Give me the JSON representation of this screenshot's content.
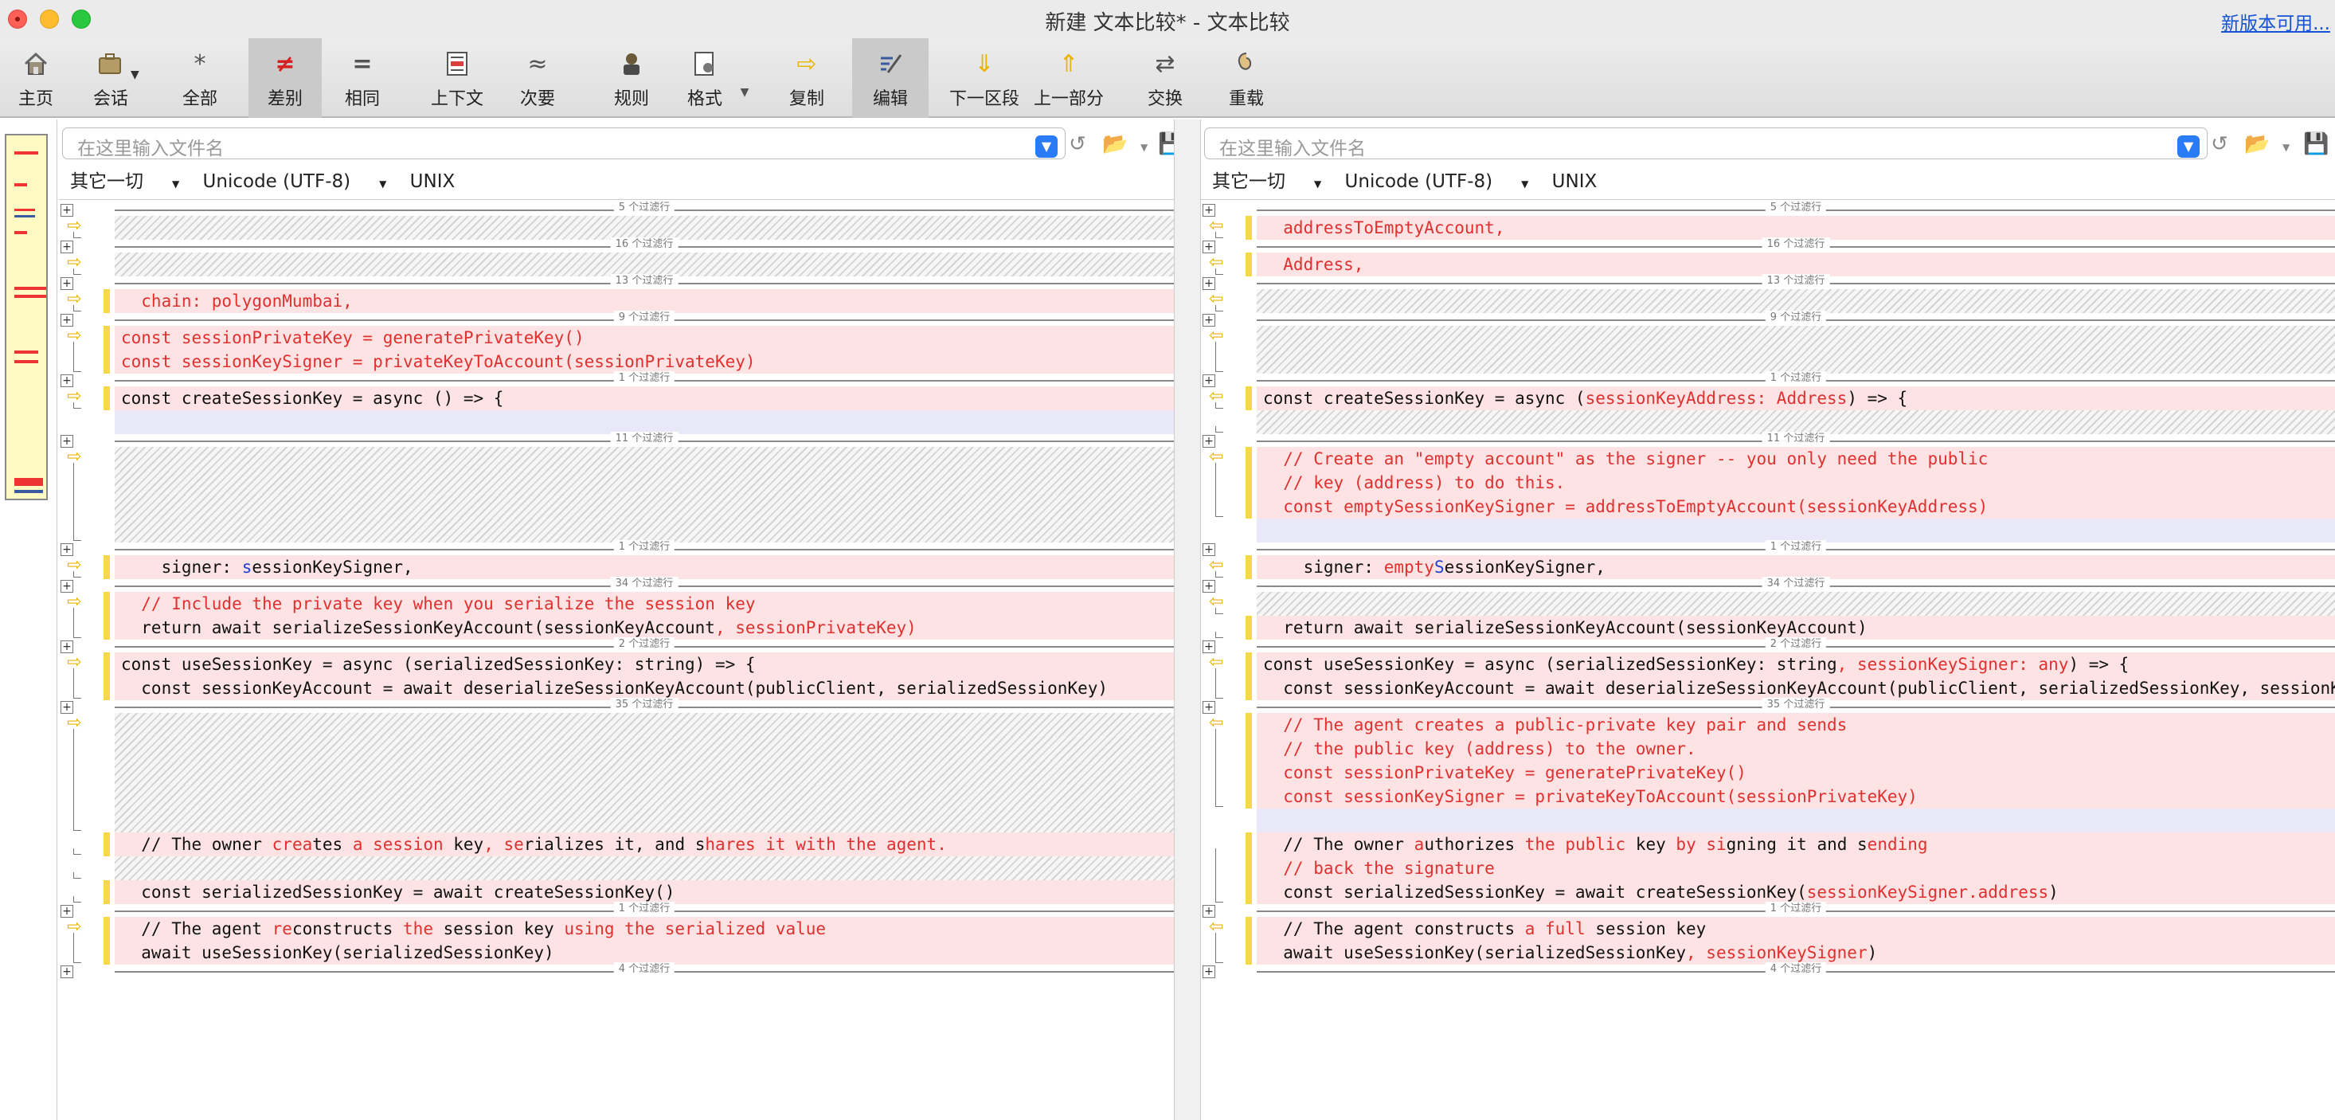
{
  "window": {
    "title": "新建 文本比较* - 文本比较",
    "update_link": "新版本可用..."
  },
  "toolbar": {
    "home": "主页",
    "session": "会话",
    "all": "全部",
    "diffs": "差别",
    "same": "相同",
    "context": "上下文",
    "minor": "次要",
    "rules": "规则",
    "format": "格式",
    "copy": "复制",
    "edit": "编辑",
    "next": "下一区段",
    "prev": "上一部分",
    "swap": "交换",
    "reload": "重载"
  },
  "icons": {
    "home": "home-icon",
    "session": "briefcase-icon",
    "all": "asterisk-icon",
    "diffs": "not-equal-icon",
    "same": "equals-icon",
    "context": "context-icon",
    "minor": "approx-icon",
    "rules": "rules-icon",
    "format": "format-icon",
    "copy": "copy-arrow-icon",
    "edit": "edit-icon",
    "next": "down-arrow-icon",
    "prev": "up-arrow-icon",
    "swap": "swap-icon",
    "reload": "reload-icon"
  },
  "colors": {
    "diff_bg": "#fde3e3",
    "diff_text": "#e03030",
    "gap": "#d4d4d4",
    "marker": "#f5d94a",
    "dropdown": "#2a7cf6"
  },
  "left": {
    "filename_placeholder": "在这里输入文件名",
    "filter": "其它一切",
    "encoding": "Unicode (UTF-8)",
    "line_ending": "UNIX",
    "separators": [
      "5 个过滤行",
      "16 个过滤行",
      "13 个过滤行",
      "9 个过滤行",
      "1 个过滤行",
      "11 个过滤行",
      "1 个过滤行",
      "34 个过滤行",
      "2 个过滤行",
      "35 个过滤行",
      "1 个过滤行",
      "4 个过滤行"
    ],
    "lines": {
      "chain": "  chain: polygonMumbai,",
      "spk": "const sessionPrivateKey = generatePrivateKey()",
      "sks": "const sessionKeySigner = privateKeyToAccount(sessionPrivateKey)",
      "csk": "const createSessionKey = async () => {",
      "signer_a": "    signer: ",
      "signer_b": "s",
      "signer_c": "essionKeySigner,",
      "include": "  // Include the private key when you serialize the session key",
      "ret_a": "  return await serializeSessionKeyAccount(sessionKeyAccount",
      "ret_b": ", sessionPrivateKey)",
      "usk": "const useSessionKey = async (serializedSessionKey: string) => {",
      "deser": "  const sessionKeyAccount = await deserializeSessionKeyAccount(publicClient, serializedSessionKey)",
      "owner": "  // The owner creates a session key, serializes it, and shares it with the agent.",
      "serk": "  const serializedSessionKey = await createSessionKey()",
      "agent": "  // The agent reconstructs the session key using the serialized value",
      "await": "  await useSessionKey(serializedSessionKey)"
    }
  },
  "right": {
    "filename_placeholder": "在这里输入文件名",
    "filter": "其它一切",
    "encoding": "Unicode (UTF-8)",
    "line_ending": "UNIX",
    "separators": [
      "5 个过滤行",
      "16 个过滤行",
      "13 个过滤行",
      "9 个过滤行",
      "1 个过滤行",
      "11 个过滤行",
      "1 个过滤行",
      "34 个过滤行",
      "2 个过滤行",
      "35 个过滤行",
      "1 个过滤行",
      "4 个过滤行"
    ],
    "lines": {
      "addr": "  addressToEmptyAccount,",
      "address": "  Address,",
      "csk_a": "const createSessionKey = async (",
      "csk_b": "sessionKeyAddress: Address",
      "csk_c": ") => {",
      "c1": "  // Create an \"empty account\" as the signer -- you only need the public",
      "c2": "  // key (address) to do this.",
      "c3": "  const emptySessionKeySigner = addressToEmptyAccount(sessionKeyAddress)",
      "signer_a": "    signer: ",
      "signer_b": "empty",
      "signer_c": "S",
      "signer_d": "essionKeySigner,",
      "ret": "  return await serializeSessionKeyAccount(sessionKeyAccount)",
      "usk_a": "const useSessionKey = async (serializedSessionKey: string",
      "usk_b": ", sessionKeySigner: any",
      "usk_c": ") => {",
      "deser": "  const sessionKeyAccount = await deserializeSessionKeyAccount(publicClient, serializedSessionKey, sessionKeySigner)",
      "a1": "  // The agent creates a public-private key pair and sends",
      "a2": "  // the public key (address) to the owner.",
      "a3": "  const sessionPrivateKey = generatePrivateKey()",
      "a4": "  const sessionKeySigner = privateKeyToAccount(sessionPrivateKey)",
      "own1": "  // The owner authorizes the public key by signing it and sending",
      "own2": "  // back the signature",
      "serk_a": "  const serializedSessionKey = await createSessionKey(",
      "serk_b": "sessionKeySigner.address",
      "serk_c": ")",
      "agent": "  // The agent constructs a full session key",
      "await_a": "  await useSessionKey(serializedSessionKey",
      "await_b": ", sessionKeySigner",
      "await_c": ")"
    }
  }
}
